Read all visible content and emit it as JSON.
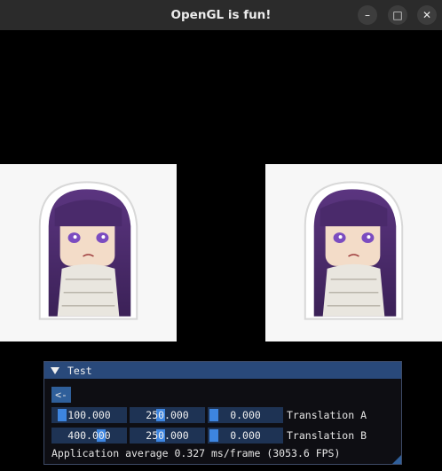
{
  "window": {
    "title": "OpenGL is fun!"
  },
  "titlebar_buttons": {
    "minimize_icon": "–",
    "maximize_icon": "□",
    "close_icon": "✕"
  },
  "imgui_panel": {
    "title": "Test",
    "back_button": "<-",
    "rows": [
      {
        "label": "Translation A",
        "values": [
          "100.000",
          "250.000",
          "0.000"
        ],
        "fractions": [
          0.0769,
          0.4,
          0.0
        ]
      },
      {
        "label": "Translation B",
        "values": [
          "400.000",
          "250.000",
          "0.000"
        ],
        "fractions": [
          0.6923,
          0.4,
          0.0
        ]
      }
    ],
    "stats": "Application average 0.327 ms/frame (3053.6 FPS)"
  },
  "colors": {
    "title_bar": "#29497a",
    "slider_bg": "#1e3354",
    "slider_grab": "#3d85e0",
    "button": "#2f5f9a"
  }
}
